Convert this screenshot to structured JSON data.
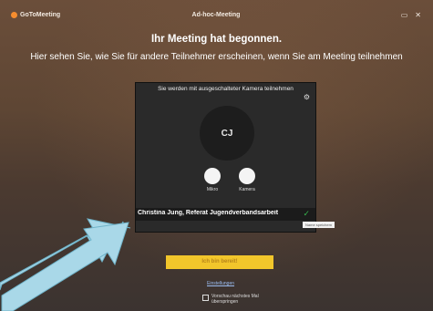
{
  "app": {
    "logo_text": "GoToMeeting",
    "window_title": "Ad-hoc-Meeting"
  },
  "heading": "Ihr Meeting hat begonnen.",
  "subheading": "Hier sehen Sie, wie Sie für andere Teilnehmer erscheinen, wenn Sie am Meeting teilnehmen",
  "preview": {
    "camera_note": "Sie werden mit ausgeschalteter Kamera teilnehmen",
    "avatar_initials": "CJ",
    "toggles": [
      {
        "label": "Mikro"
      },
      {
        "label": "Kamera"
      }
    ],
    "name_value": "Christina Jung, Referat Jugendverbandsarbeit",
    "tooltip": "Name speichern"
  },
  "join_button": "Ich bin bereit!",
  "settings_link": "Einstellungen",
  "skip_preview": {
    "label": "Vorschau nächstes Mal überspringen",
    "checked": false
  },
  "colors": {
    "accent": "#f2c62b",
    "brand": "#f68d2e",
    "confirm": "#37b24d"
  }
}
